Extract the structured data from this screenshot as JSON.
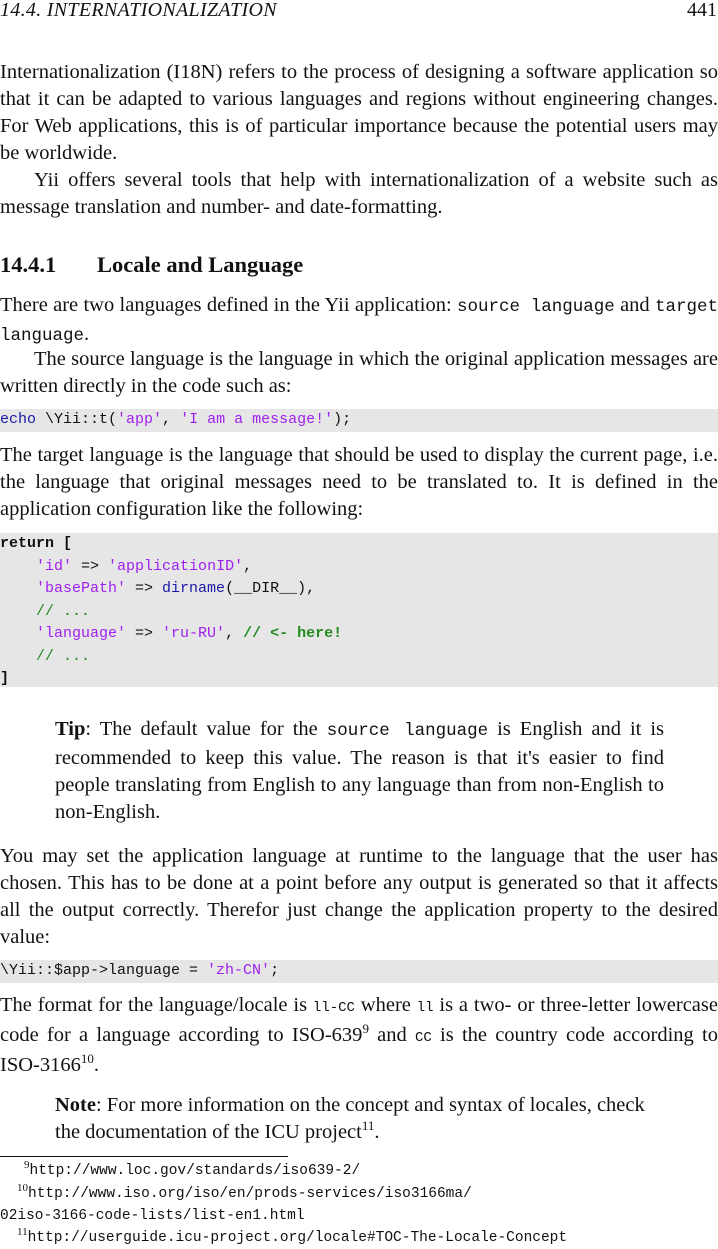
{
  "header": {
    "section": "14.4.  INTERNATIONALIZATION",
    "page_number": "441"
  },
  "intro": {
    "p1": "Internationalization (I18N) refers to the process of designing a software application so that it can be adapted to various languages and regions without engineering changes. For Web applications, this is of particular importance because the potential users may be worldwide.",
    "p2": "Yii offers several tools that help with internationalization of a website such as message translation and number- and date-formatting."
  },
  "section": {
    "number": "14.4.1",
    "title": "Locale and Language"
  },
  "langs": {
    "p1_before": "There are two languages defined in the Yii application: ",
    "source_language": "source language",
    "p1_and": "and ",
    "target_language": "target language",
    "p1_end": ".",
    "p2": "The source language is the language in which the original application messages are written directly in the code such as:"
  },
  "code1": {
    "echo": "echo",
    "call": " \\Yii::t(",
    "arg1": "'app'",
    "sep": ", ",
    "arg2": "'I am a message!'",
    "end": ");"
  },
  "target_para": "The target language is the language that should be used to display the current page, i.e. the language that original messages need to be translated to. It is defined in the application configuration like the following:",
  "code2": {
    "l1": "return [",
    "l2_key": "'id'",
    "l2_arrow": " => ",
    "l2_val": "'applicationID'",
    "l2_end": ",",
    "l3_key": "'basePath'",
    "l3_arrow": " => ",
    "l3_fn": "dirname",
    "l3_rest": "(__DIR__),",
    "l4": "// ...",
    "l5_key": "'language'",
    "l5_arrow": " => ",
    "l5_val": "'ru-RU'",
    "l5_sep": ", ",
    "l5_cmt": "// <- here!",
    "l6": "// ...",
    "l7": "]"
  },
  "tip": {
    "lead": "Tip",
    "text_before": ": The default value for the ",
    "code": "source language",
    "text_after": " is English and it is recommended to keep this value. The reason is that it's easier to find people translating from English to any language than from non-English to non-English."
  },
  "runtime_para": "You may set the application language at runtime to the language that the user has chosen. This has to be done at a point before any output is generated so that it affects all the output correctly. Therefor just change the application property to the desired value:",
  "code3": {
    "pre": "\\Yii::$app->language = ",
    "val": "'zh-CN'",
    "end": ";"
  },
  "format_para": {
    "t1": "The format for the language/locale is ",
    "c1": "ll-CC",
    "t2": " where ",
    "c2": "ll",
    "t3": " is a two- or three-letter lowercase code for a language according to ISO-639",
    "s1": "9",
    "t4": " and ",
    "c3": "CC",
    "t5": " is the country code according to ISO-3166",
    "s2": "10",
    "t6": "."
  },
  "note": {
    "lead": "Note",
    "text": ": For more information on the concept and syntax of locales, check the documentation of the ICU project",
    "sup": "11",
    "end": "."
  },
  "footnotes": [
    {
      "mark": "9",
      "url": "http://www.loc.gov/standards/iso639-2/"
    },
    {
      "mark": "10",
      "url": "http://www.iso.org/iso/en/prods-services/iso3166ma/",
      "cont": "02iso-3166-code-lists/list-en1.html"
    },
    {
      "mark": "11",
      "url": "http://userguide.icu-project.org/locale#TOC-The-Locale-Concept"
    }
  ]
}
